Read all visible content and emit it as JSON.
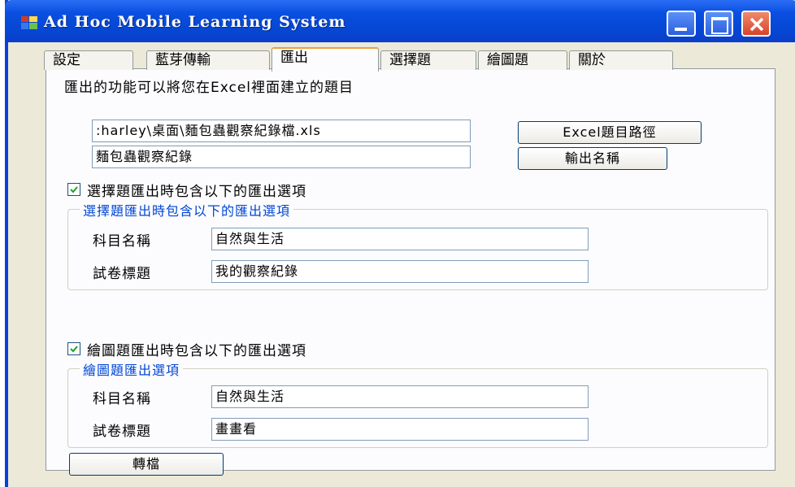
{
  "window": {
    "title": "Ad Hoc Mobile Learning System"
  },
  "tabs": [
    {
      "label": "設定"
    },
    {
      "label": "藍芽傳輸"
    },
    {
      "label": "匯出"
    },
    {
      "label": "選擇題"
    },
    {
      "label": "繪圖題"
    },
    {
      "label": "關於"
    }
  ],
  "export": {
    "description": "匯出的功能可以將您在Excel裡面建立的題目",
    "path_value": ":harley\\桌面\\麵包蟲觀察紀錄檔.xls",
    "output_name_value": "麵包蟲觀察紀錄",
    "excel_path_button": "Excel題目路徑",
    "output_name_button": "輸出名稱",
    "mc_checkbox_label": "選擇題匯出時包含以下的匯出選項",
    "mc_group_title": "選擇題匯出時包含以下的匯出選項",
    "mc_subject_label": "科目名稱",
    "mc_subject_value": "自然與生活",
    "mc_title_label": "試卷標題",
    "mc_title_value": "我的觀察紀錄",
    "draw_checkbox_label": "繪圖題匯出時包含以下的匯出選項",
    "draw_group_title": "繪圖題匯出選項",
    "draw_subject_label": "科目名稱",
    "draw_subject_value": "自然與生活",
    "draw_title_label": "試卷標題",
    "draw_title_value": "畫畫看",
    "convert_button": "轉檔"
  },
  "colors": {
    "titlebar": "#0547d4",
    "accent_legend": "#0046d5",
    "tab_highlight": "#e8a33d"
  }
}
